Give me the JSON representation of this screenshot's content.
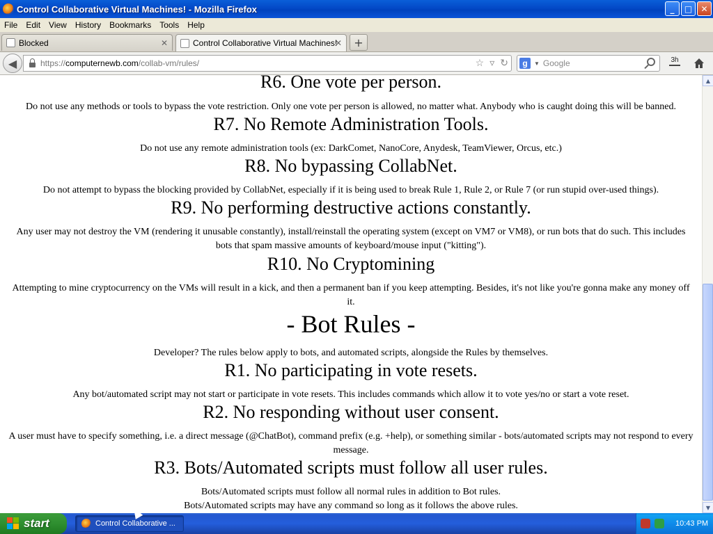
{
  "window": {
    "title": "Control Collaborative Virtual Machines! - Mozilla Firefox",
    "buttons": {
      "minimize": "_",
      "maximize": "□",
      "close": "✕"
    }
  },
  "menu": [
    "File",
    "Edit",
    "View",
    "History",
    "Bookmarks",
    "Tools",
    "Help"
  ],
  "tabs": [
    {
      "label": "Blocked",
      "active": false
    },
    {
      "label": "Control Collaborative Virtual Machines!",
      "active": true
    }
  ],
  "new_tab_label": "+",
  "navbar": {
    "url_scheme": "https://",
    "url_host": "computernewb.com",
    "url_path": "/collab-vm/rules/",
    "search_engine_icon": "g-icon",
    "search_placeholder": "Google",
    "downloads_label": "3h"
  },
  "content": {
    "rules": [
      {
        "heading": "R6. One vote per person.",
        "text": "Do not use any methods or tools to bypass the vote restriction. Only one vote per person is allowed, no matter what. Anybody who is caught doing this will be banned."
      },
      {
        "heading": "R7. No Remote Administration Tools.",
        "text": "Do not use any remote administration tools (ex: DarkComet, NanoCore, Anydesk, TeamViewer, Orcus, etc.)"
      },
      {
        "heading": "R8. No bypassing CollabNet.",
        "text": "Do not attempt to bypass the blocking provided by CollabNet, especially if it is being used to break Rule 1, Rule 2, or Rule 7 (or run stupid over-used things)."
      },
      {
        "heading": "R9. No performing destructive actions constantly.",
        "text": "Any user may not destroy the VM (rendering it unusable constantly), install/reinstall the operating system (except on VM7 or VM8), or run bots that do such. This includes bots that spam massive amounts of keyboard/mouse input (\"kitting\")."
      },
      {
        "heading": "R10. No Cryptomining",
        "text": "Attempting to mine cryptocurrency on the VMs will result in a kick, and then a permanent ban if you keep attempting. Besides, it's not like you're gonna make any money off it."
      }
    ],
    "bot_section_title": "- Bot Rules -",
    "bot_intro": "Developer? The rules below apply to bots, and automated scripts, alongside the Rules by themselves.",
    "bot_rules": [
      {
        "heading": "R1. No participating in vote resets.",
        "text": "Any bot/automated script may not start or participate in vote resets. This includes commands which allow it to vote yes/no or start a vote reset."
      },
      {
        "heading": "R2. No responding without user consent.",
        "text": "A user must have to specify something, i.e. a direct message (@ChatBot), command prefix (e.g. +help), or something similar - bots/automated scripts may not respond to every message."
      },
      {
        "heading": "R3. Bots/Automated scripts must follow all user rules.",
        "text": "Bots/Automated scripts must follow all normal rules in addition to Bot rules.",
        "text2": "Bots/Automated scripts may have any command so long as it follows the above rules."
      }
    ]
  },
  "taskbar": {
    "start_label": "start",
    "task_label": "Control Collaborative ...",
    "clock": "10:43 PM"
  }
}
